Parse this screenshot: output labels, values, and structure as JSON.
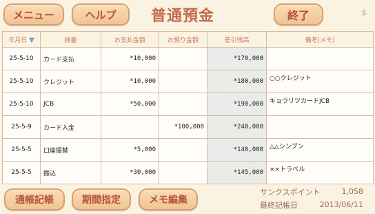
{
  "header": {
    "menu_label": "メニュー",
    "help_label": "ヘルプ",
    "title": "普通預金",
    "exit_label": "終了",
    "scroll_glyph": "⥮"
  },
  "table": {
    "columns": [
      "年月日",
      "摘要",
      "お支払金額",
      "お預り金額",
      "差引残高",
      "備考(メモ)"
    ],
    "sort_icon": "▼",
    "rows": [
      {
        "date": "25-5-10",
        "description": "カード支払",
        "payment": "*10,000",
        "deposit": "",
        "balance": "*170,000",
        "memo": ""
      },
      {
        "date": "25-5-10",
        "description": "クレジット",
        "payment": "*10,000",
        "deposit": "",
        "balance": "*180,000",
        "memo": "○○クレジット"
      },
      {
        "date": "25-5-10",
        "description": "JCB",
        "payment": "*50,000",
        "deposit": "",
        "balance": "*190,000",
        "memo": "キョウリツカードJCB"
      },
      {
        "date": "25-5-9",
        "description": "カード入金",
        "payment": "",
        "deposit": "*100,000",
        "balance": "*240,000",
        "memo": ""
      },
      {
        "date": "25-5-5",
        "description": "口座振替",
        "payment": "*5,000",
        "deposit": "",
        "balance": "*140,000",
        "memo": "△△シンブン"
      },
      {
        "date": "25-5-5",
        "description": "振込",
        "payment": "*30,000",
        "deposit": "",
        "balance": "*145,000",
        "memo": "××トラベル"
      }
    ]
  },
  "footer": {
    "passbook_label": "通帳記帳",
    "period_label": "期間指定",
    "memo_edit_label": "メモ編集",
    "points_label": "サンクスポイント",
    "points_value": "1,058",
    "last_entry_label": "最終記帳日",
    "last_entry_value": "2013/06/11"
  },
  "colors": {
    "background": "#fbf3e2",
    "button": "#f2c394",
    "accent": "#c46a4d",
    "grid": "#d9b9a4"
  }
}
